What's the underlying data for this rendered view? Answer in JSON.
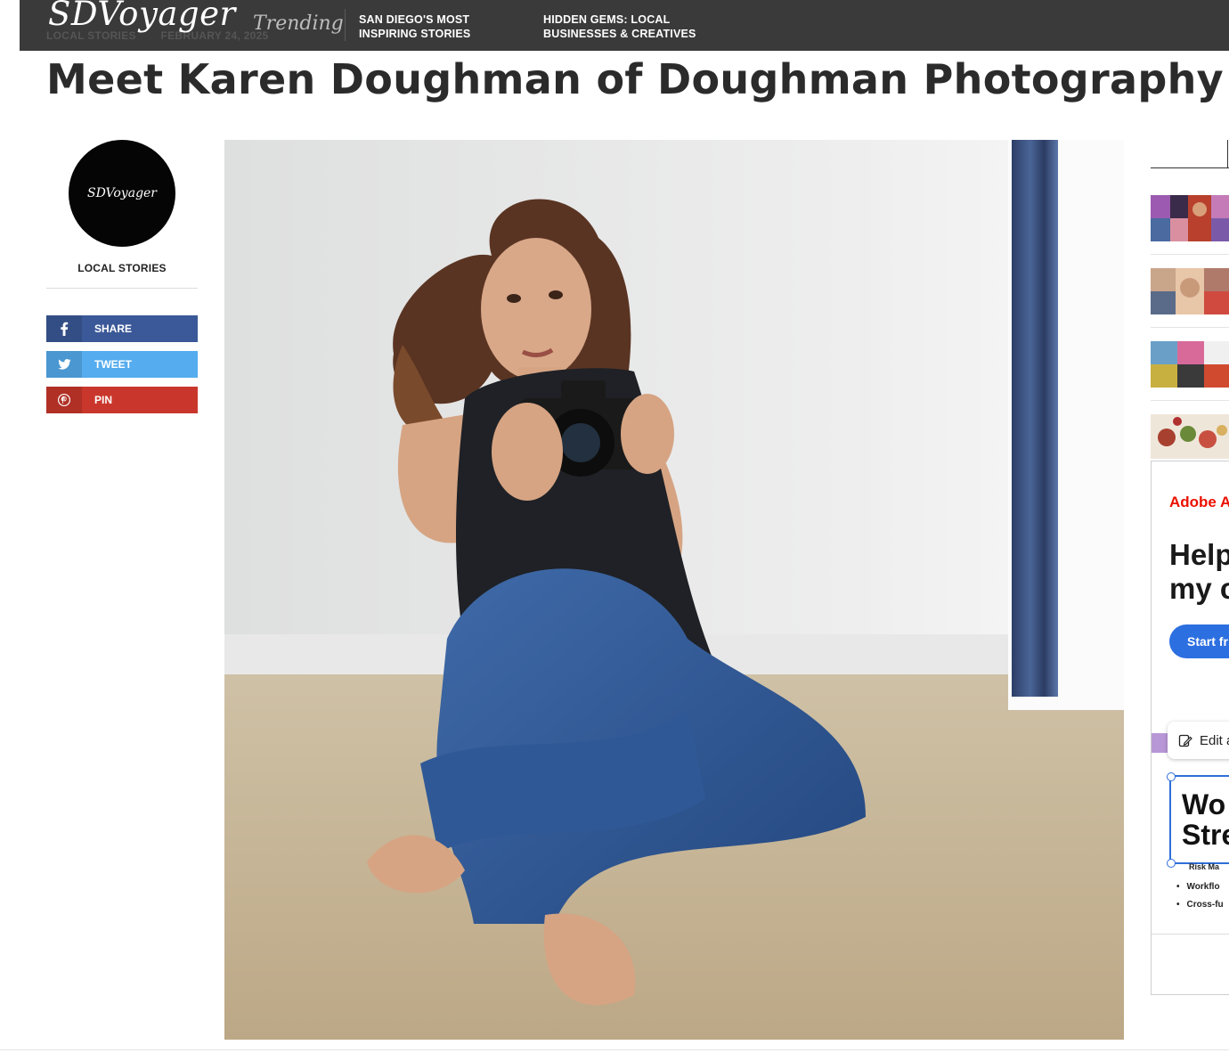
{
  "header": {
    "logo": "SDVoyager",
    "meta_category": "LOCAL STORIES",
    "meta_date": "FEBRUARY 24, 2025",
    "trending_label": "Trending",
    "trending": [
      "SAN DIEGO'S MOST INSPIRING STORIES",
      "HIDDEN GEMS: LOCAL BUSINESSES & CREATIVES"
    ]
  },
  "article": {
    "title": "Meet Karen Doughman of Doughman Photography"
  },
  "author": {
    "avatar_text": "SDVoyager",
    "label": "LOCAL STORIES"
  },
  "share": {
    "facebook": "SHARE",
    "twitter": "TWEET",
    "pinterest": "PIN"
  },
  "ad": {
    "brand": "Adobe A",
    "headline_1": "Help",
    "headline_2": "my c",
    "cta": "Start fr",
    "edit": "Edit a",
    "frame_title_1": "Wo",
    "frame_title_2": "Stre",
    "partial_line": "Risk Ma",
    "bullets": [
      "Workflo",
      "Cross-fu"
    ]
  },
  "colors": {
    "topbar": "#3a3a3a",
    "facebook": "#3b5998",
    "twitter": "#55acee",
    "pinterest": "#c9372c",
    "adobe_red": "#eb1000",
    "adobe_blue": "#2c6fe0"
  }
}
